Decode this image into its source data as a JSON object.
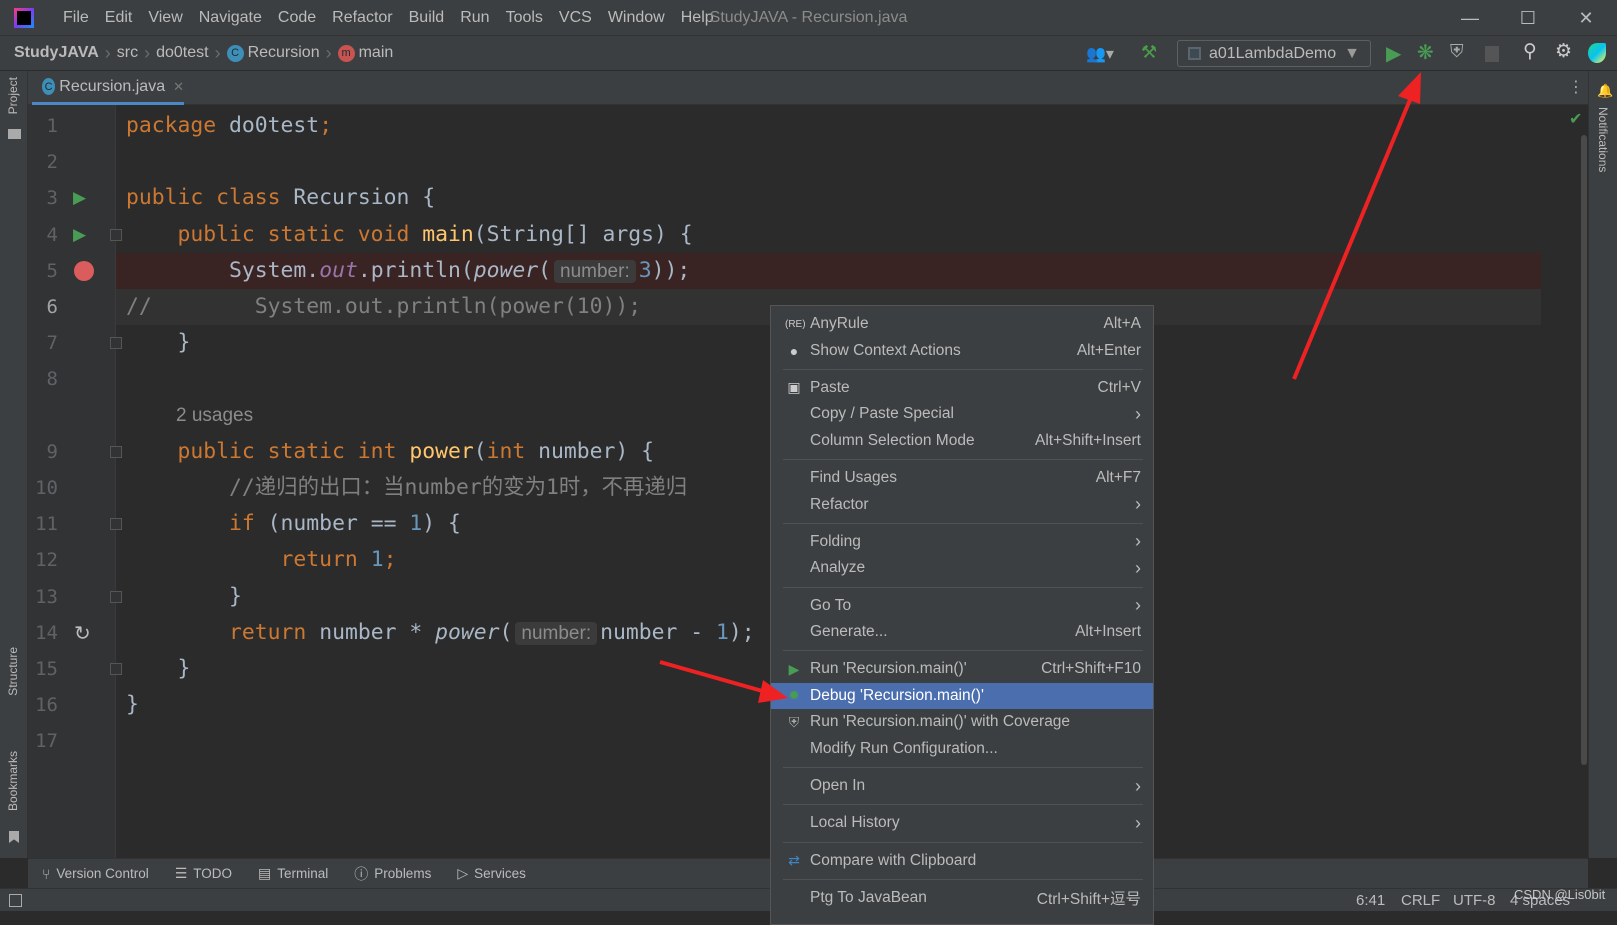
{
  "window": {
    "title": "StudyJAVA - Recursion.java",
    "controls": [
      "minimize",
      "maximize",
      "close"
    ]
  },
  "menubar": [
    "File",
    "Edit",
    "View",
    "Navigate",
    "Code",
    "Refactor",
    "Build",
    "Run",
    "Tools",
    "VCS",
    "Window",
    "Help"
  ],
  "breadcrumb": [
    {
      "label": "StudyJAVA",
      "icon": null
    },
    {
      "label": "src",
      "icon": null
    },
    {
      "label": "do0test",
      "icon": null
    },
    {
      "label": "Recursion",
      "icon": "class-icon"
    },
    {
      "label": "main",
      "icon": "method-icon"
    }
  ],
  "toolbar": {
    "run_config": "a01LambdaDemo"
  },
  "tab": {
    "label": "Recursion.java"
  },
  "side": {
    "project": "Project",
    "structure": "Structure",
    "bookmarks": "Bookmarks",
    "notifications": "Notifications"
  },
  "code": [
    {
      "n": "1",
      "t": [
        [
          "package ",
          "kw"
        ],
        [
          "do0test",
          "id"
        ],
        [
          ";",
          "kw"
        ]
      ]
    },
    {
      "n": "2",
      "t": []
    },
    {
      "n": "3",
      "g": "run",
      "t": [
        [
          "public class ",
          "kw"
        ],
        [
          "Recursion {",
          "id"
        ]
      ]
    },
    {
      "n": "4",
      "g": "run",
      "f": 1,
      "t": [
        [
          "    public static void ",
          "kw"
        ],
        [
          "main",
          "fn"
        ],
        [
          "(String[] args) {",
          "id"
        ]
      ]
    },
    {
      "n": "5",
      "g": "bp",
      "bp": 1,
      "t": [
        [
          "        System.",
          "id"
        ],
        [
          "out",
          "fld"
        ],
        [
          ".println(",
          "id"
        ],
        [
          "power",
          "it"
        ],
        [
          "(",
          "id"
        ],
        [
          "number:",
          "hint"
        ],
        [
          "3",
          "num"
        ],
        [
          "));",
          "id"
        ]
      ]
    },
    {
      "n": "6",
      "cur": 1,
      "t": [
        [
          "//        System.out.println(power(10));",
          "cm"
        ]
      ]
    },
    {
      "n": "7",
      "f": 1,
      "t": [
        [
          "    }",
          "id"
        ]
      ]
    },
    {
      "n": "8",
      "t": []
    },
    {
      "usage": "2 usages"
    },
    {
      "n": "9",
      "f": 1,
      "t": [
        [
          "    public static int ",
          "kw"
        ],
        [
          "power",
          "fn"
        ],
        [
          "(",
          "id"
        ],
        [
          "int ",
          "kw"
        ],
        [
          "number) {",
          "id"
        ]
      ]
    },
    {
      "n": "10",
      "t": [
        [
          "        //递归的出口：当number的变为1时，不再递归",
          "cm"
        ]
      ]
    },
    {
      "n": "11",
      "f": 1,
      "t": [
        [
          "        if ",
          "kw"
        ],
        [
          "(number == ",
          "id"
        ],
        [
          "1",
          "num"
        ],
        [
          ") {",
          "id"
        ]
      ]
    },
    {
      "n": "12",
      "t": [
        [
          "            return ",
          "kw"
        ],
        [
          "1",
          "num"
        ],
        [
          ";",
          "kw"
        ]
      ]
    },
    {
      "n": "13",
      "f": 1,
      "t": [
        [
          "        }",
          "id"
        ]
      ]
    },
    {
      "n": "14",
      "g": "rec",
      "t": [
        [
          "        return ",
          "kw"
        ],
        [
          "number * ",
          "id"
        ],
        [
          "power",
          "it"
        ],
        [
          "(",
          "id"
        ],
        [
          "number:",
          "hint"
        ],
        [
          "number - ",
          "id"
        ],
        [
          "1",
          "num"
        ],
        [
          ");",
          "id"
        ]
      ]
    },
    {
      "n": "15",
      "f": 1,
      "t": [
        [
          "    }",
          "id"
        ]
      ]
    },
    {
      "n": "16",
      "t": [
        [
          "}",
          "id"
        ]
      ]
    },
    {
      "n": "17",
      "t": []
    }
  ],
  "context_menu": [
    {
      "label": "AnyRule",
      "shortcut": "Alt+A",
      "icon": "regex-icon"
    },
    {
      "label": "Show Context Actions",
      "shortcut": "Alt+Enter",
      "icon": "bulb-icon"
    },
    {
      "sep": true
    },
    {
      "label": "Paste",
      "shortcut": "Ctrl+V",
      "icon": "clipboard-icon"
    },
    {
      "label": "Copy / Paste Special",
      "submenu": true
    },
    {
      "label": "Column Selection Mode",
      "shortcut": "Alt+Shift+Insert"
    },
    {
      "sep": true
    },
    {
      "label": "Find Usages",
      "shortcut": "Alt+F7"
    },
    {
      "label": "Refactor",
      "submenu": true
    },
    {
      "sep": true
    },
    {
      "label": "Folding",
      "submenu": true
    },
    {
      "label": "Analyze",
      "submenu": true
    },
    {
      "sep": true
    },
    {
      "label": "Go To",
      "submenu": true
    },
    {
      "label": "Generate...",
      "shortcut": "Alt+Insert"
    },
    {
      "sep": true
    },
    {
      "label": "Run 'Recursion.main()'",
      "shortcut": "Ctrl+Shift+F10",
      "icon": "run-icon"
    },
    {
      "label": "Debug 'Recursion.main()'",
      "icon": "debug-icon",
      "selected": true
    },
    {
      "label": "Run 'Recursion.main()' with Coverage",
      "icon": "coverage-icon"
    },
    {
      "label": "Modify Run Configuration..."
    },
    {
      "sep": true
    },
    {
      "label": "Open In",
      "submenu": true
    },
    {
      "sep": true
    },
    {
      "label": "Local History",
      "submenu": true
    },
    {
      "sep": true
    },
    {
      "label": "Compare with Clipboard",
      "icon": "compare-icon"
    },
    {
      "sep": true
    },
    {
      "label": "Ptg To JavaBean",
      "shortcut": "Ctrl+Shift+逗号"
    }
  ],
  "bottom_tools": [
    {
      "label": "Version Control",
      "icon": "vcs-icon"
    },
    {
      "label": "TODO",
      "icon": "list-icon"
    },
    {
      "label": "Terminal",
      "icon": "terminal-icon"
    },
    {
      "label": "Problems",
      "icon": "problems-icon"
    },
    {
      "label": "Services",
      "icon": "services-icon"
    }
  ],
  "status": {
    "position": "6:41",
    "line_sep": "CRLF",
    "encoding": "UTF-8",
    "indent": "4 spaces",
    "watermark": "CSDN @Lis0bit"
  },
  "colors": {
    "keyword": "#cc7832",
    "method": "#ffc66d",
    "number": "#6897bb",
    "field": "#9876aa",
    "comment": "#808080",
    "selection": "#4b6eaf",
    "annotation_arrow": "#ee2222"
  }
}
